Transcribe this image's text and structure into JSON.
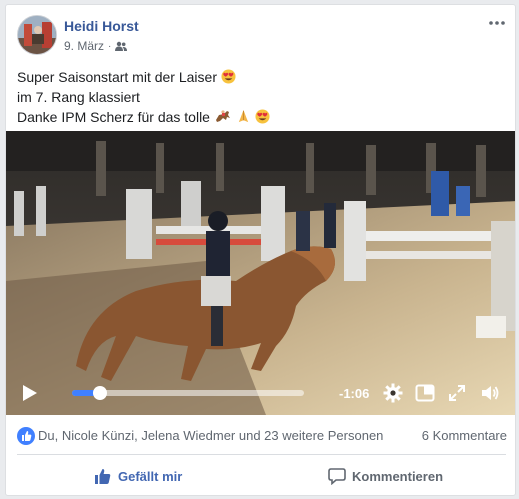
{
  "post": {
    "author": "Heidi Horst",
    "date": "9. März",
    "date_separator": "·",
    "audience_icon": "friends-icon",
    "text_line1": "Super Saisonstart mit der Laiser",
    "text_line2": "im 7. Rang klassiert",
    "text_line3": "Danke IPM Scherz für das tolle"
  },
  "video": {
    "time_remaining": "-1:06",
    "progress": 0.12,
    "icons": [
      "play-icon",
      "settings-gear-icon",
      "picture-in-picture-icon",
      "fullscreen-icon",
      "volume-icon"
    ]
  },
  "reactions": {
    "text": "Du, Nicole Künzi, Jelena Wiedmer und 23 weitere Personen",
    "comments": "6 Kommentare"
  },
  "actions": {
    "like_label": "Gefällt mir",
    "comment_label": "Kommentieren"
  },
  "colors": {
    "link": "#385898",
    "accent": "#4267b2",
    "seek": "#4080ff"
  }
}
